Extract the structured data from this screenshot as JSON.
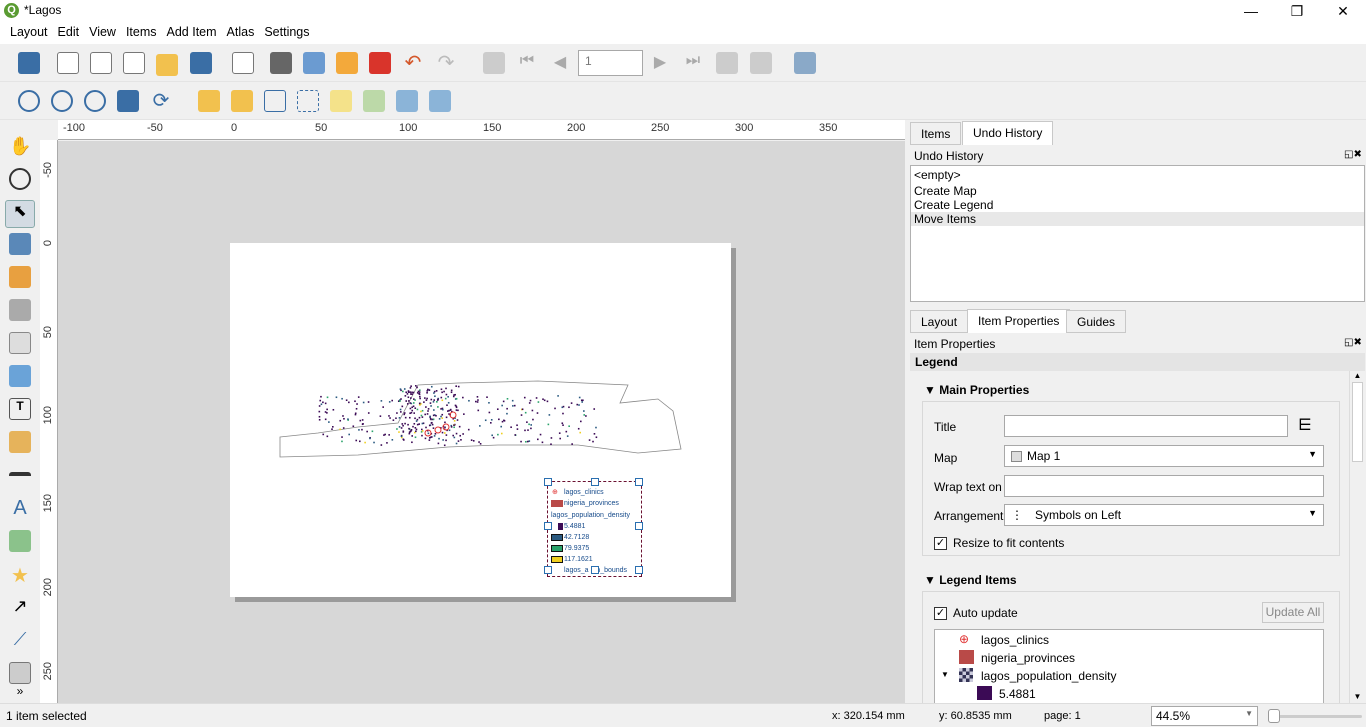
{
  "window": {
    "title": "*Lagos",
    "min": "—",
    "max": "❐",
    "close": "✕"
  },
  "menu": [
    "Layout",
    "Edit",
    "View",
    "Items",
    "Add Item",
    "Atlas",
    "Settings"
  ],
  "toolbar": {
    "page_value": "1"
  },
  "ruler": {
    "h": [
      "-100",
      "-50",
      "0",
      "50",
      "100",
      "150",
      "200",
      "250",
      "300",
      "350"
    ],
    "v": [
      "-50",
      "0",
      "50",
      "100",
      "150",
      "200",
      "250"
    ]
  },
  "legend_item": {
    "entries": [
      "lagos_clinics",
      "nigeria_provinces",
      "lagos_population_density",
      "5.4881",
      "42.7128",
      "79.9375",
      "117.1621",
      "lagos_a    n_bounds"
    ]
  },
  "top_panel": {
    "tabs": [
      "Items",
      "Undo History"
    ],
    "header": "Undo History",
    "history": [
      "<empty>",
      "Create Map",
      "Create Legend",
      "Move Items"
    ],
    "selected": 3
  },
  "bottom_panel": {
    "tabs": [
      "Layout",
      "Item Properties",
      "Guides"
    ],
    "header": "Item Properties",
    "section": "Legend",
    "main_properties": "Main Properties",
    "title_label": "Title",
    "title_value": "",
    "map_label": "Map",
    "map_value": "Map 1",
    "wrap_label": "Wrap text on",
    "wrap_value": "",
    "arrangement_label": "Arrangement",
    "arrangement_value": "Symbols on Left",
    "resize_label": "Resize to fit contents",
    "legend_items": "Legend Items",
    "auto_update": "Auto update",
    "update_all": "Update All",
    "tree": [
      "lagos_clinics",
      "nigeria_provinces",
      "lagos_population_density",
      "5.4881"
    ]
  },
  "colors": {
    "clinic": "#e03030",
    "province": "#b94a48",
    "d1": "#3b0a55",
    "d2": "#2a5a80",
    "d3": "#2aa36b",
    "d4": "#f0d020"
  },
  "status": {
    "selection": "1 item selected",
    "x": "x: 320.154 mm",
    "y": "y: 60.8535 mm",
    "page": "page: 1",
    "zoom": "44.5%"
  }
}
